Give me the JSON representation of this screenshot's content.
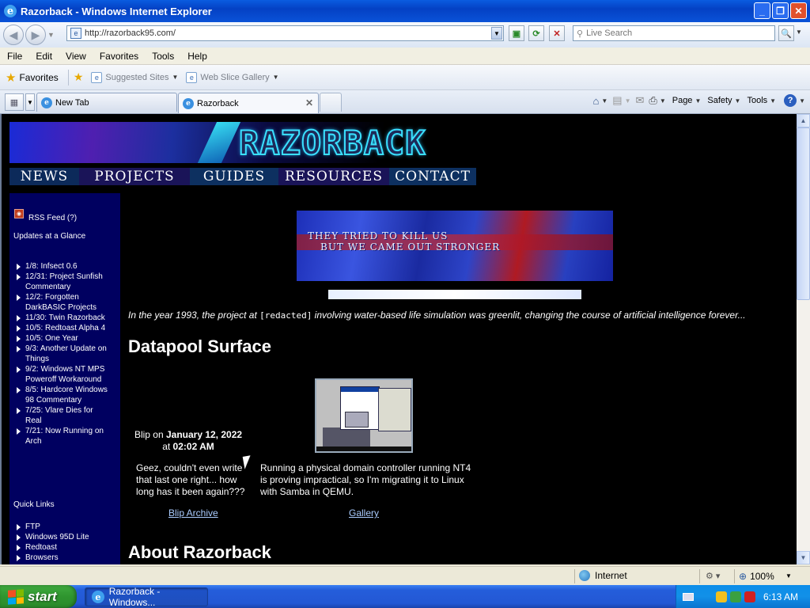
{
  "window": {
    "title": "Razorback - Windows Internet Explorer",
    "minimize": "_",
    "restore": "❐",
    "close": "✕"
  },
  "address": {
    "url": "http://razorback95.com/",
    "search_placeholder": "Live Search"
  },
  "menu": [
    "File",
    "Edit",
    "View",
    "Favorites",
    "Tools",
    "Help"
  ],
  "favorites_bar": {
    "favorites_label": "Favorites",
    "links": [
      "Suggested Sites",
      "Web Slice Gallery"
    ]
  },
  "tabs": [
    {
      "label": "New Tab",
      "active": false
    },
    {
      "label": "Razorback",
      "active": true
    }
  ],
  "command_bar": {
    "page": "Page",
    "safety": "Safety",
    "tools": "Tools"
  },
  "site": {
    "logo_text": "RAZORBACK",
    "nav": [
      "NEWS",
      "PROJECTS",
      "GUIDES",
      "RESOURCES",
      "CONTACT"
    ],
    "nav_colors": [
      "#0c2a5a",
      "#1a1458",
      "#0d3060",
      "#1a1458",
      "#0d3060"
    ],
    "sidebar": {
      "rss_label": "RSS Feed (?)",
      "updates_heading": "Updates at a Glance",
      "updates": [
        "1/8: Infsect 0.6",
        "12/31: Project Sunfish Commentary",
        "12/2: Forgotten DarkBASIC Projects",
        "11/30: Twin Razorback",
        "10/5: Redtoast Alpha 4",
        "10/5: One Year",
        "9/3: Another Update on Things",
        "9/2: Windows NT MPS Poweroff Workaround",
        "8/5: Hardcore Windows 98 Commentary",
        "7/25: Vlare Dies for Real",
        "7/21: Now Running on Arch"
      ],
      "quick_links_heading": "Quick Links",
      "quick_links": [
        "FTP",
        "Windows 95D Lite",
        "Redtoast",
        "Browsers"
      ]
    },
    "hero_line1": "THEY TRIED TO KILL US",
    "hero_line2": "BUT WE CAME OUT STRONGER",
    "intro_before": "In the year 1993, the project at ",
    "intro_code": "[redacted]",
    "intro_after": " involving water-based life simulation was greenlit, changing the course of artificial intelligence forever...",
    "datapool_heading": "Datapool Surface",
    "blip": {
      "by": "Blip on ",
      "date": "January 12, 2022",
      "at": "at ",
      "time": "02:02 AM",
      "text": "Geez, couldn't even write that last one right... how long has it been again???",
      "link": "Blip Archive"
    },
    "gallery": {
      "text": "Running a physical domain controller running NT4 is proving impractical, so I'm migrating it to Linux with Samba in QEMU.",
      "link": "Gallery"
    },
    "about_heading": "About Razorback"
  },
  "status": {
    "zone": "Internet",
    "zoom": "100%"
  },
  "taskbar": {
    "start": "start",
    "task": "Razorback - Windows...",
    "clock": "6:13 AM"
  }
}
